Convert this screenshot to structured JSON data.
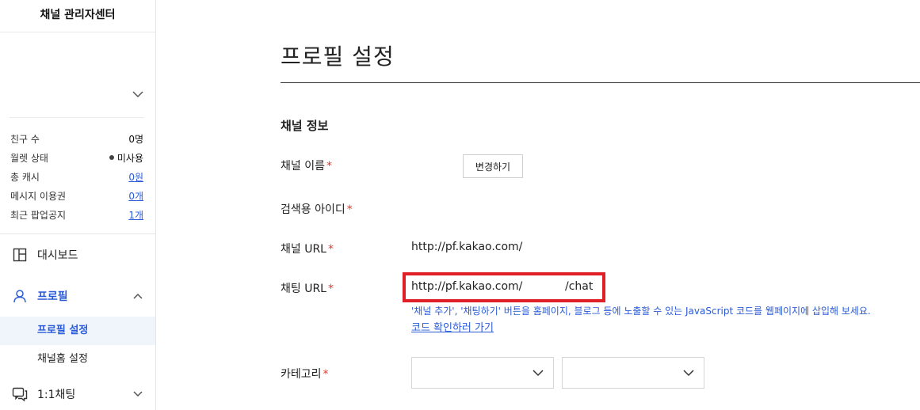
{
  "sidebar": {
    "title": "채널 관리자센터",
    "stats": [
      {
        "label": "친구 수",
        "value": "0명",
        "link": false,
        "dot": false
      },
      {
        "label": "월렛 상태",
        "value": "미사용",
        "link": false,
        "dot": true
      },
      {
        "label": "총 캐시",
        "value": "0원",
        "link": true,
        "dot": false
      },
      {
        "label": "메시지 이용권",
        "value": "0개",
        "link": true,
        "dot": false
      },
      {
        "label": "최근 팝업공지",
        "value": "1개",
        "link": true,
        "dot": false
      }
    ],
    "nav": {
      "dashboard": "대시보드",
      "profile": "프로필",
      "profile_settings": "프로필 설정",
      "channel_home_settings": "채널홈 설정",
      "chat": "1:1채팅"
    }
  },
  "main": {
    "page_title": "프로필 설정",
    "section_title": "채널 정보",
    "fields": {
      "channel_name_label": "채널 이름",
      "search_id_label": "검색용 아이디",
      "channel_url_label": "채널 URL",
      "chat_url_label": "채팅 URL",
      "category_label": "카테고리",
      "required_mark": "*"
    },
    "change_button": "변경하기",
    "channel_url_value": "http://pf.kakao.com/",
    "chat_url_prefix": "http://pf.kakao.com/",
    "chat_url_suffix": "/chat",
    "help_text": "'채널 추가', '채팅하기' 버튼을 홈페이지, 블로그 등에 노출할 수 있는 JavaScript 코드를 웹페이지에 삽입해 보세요.",
    "help_link": "코드 확인하러 가기"
  },
  "colors": {
    "accent": "#2a5bd7",
    "required": "#e5372b",
    "highlight_box": "#e01f26"
  }
}
